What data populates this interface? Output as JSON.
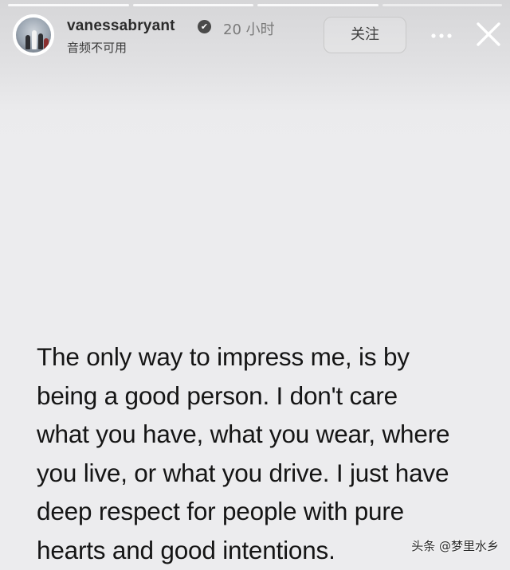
{
  "header": {
    "username": "vanessabryant",
    "verified_badge": "✔",
    "time_ago": "20 小时",
    "audio_status": "音频不可用",
    "follow_label": "关注",
    "more_icon": "more-horizontal-icon",
    "close_icon": "close-icon"
  },
  "story": {
    "text_lines": [
      "The only way to impress me, is by",
      "being a good person. I don't care",
      "what you have, what you wear, where",
      "you live, or what you drive. I just have",
      "deep respect for people with pure",
      "hearts and good intentions."
    ]
  },
  "watermark": "头条 @梦里水乡"
}
